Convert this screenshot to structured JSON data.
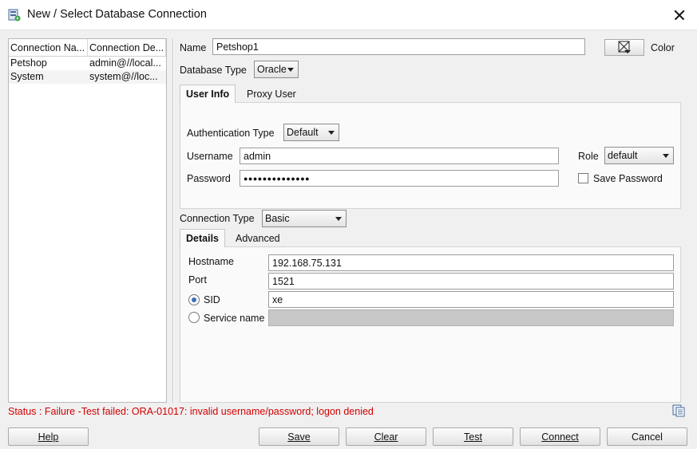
{
  "window": {
    "title": "New / Select Database Connection"
  },
  "connections": {
    "columns": [
      "Connection Na...",
      "Connection De..."
    ],
    "rows": [
      {
        "name": "Petshop",
        "details": "admin@//local..."
      },
      {
        "name": "System",
        "details": "system@//loc..."
      }
    ]
  },
  "form": {
    "name_label": "Name",
    "name_value": "Petshop1",
    "color_label": "Color",
    "db_type_label": "Database Type",
    "db_type_value": "Oracle",
    "tabs": [
      "User Info",
      "Proxy User"
    ],
    "auth_type_label": "Authentication Type",
    "auth_type_value": "Default",
    "username_label": "Username",
    "username_value": "admin",
    "password_label": "Password",
    "password_value": "●●●●●●●●●●●●●●",
    "role_label": "Role",
    "role_value": "default",
    "save_password_label": "Save Password",
    "conn_type_label": "Connection Type",
    "conn_type_value": "Basic",
    "detail_tabs": [
      "Details",
      "Advanced"
    ],
    "hostname_label": "Hostname",
    "hostname_value": "192.168.75.131",
    "port_label": "Port",
    "port_value": "1521",
    "sid_label": "SID",
    "sid_value": "xe",
    "service_label": "Service name",
    "service_value": ""
  },
  "status": {
    "text": "Status : Failure -Test failed: ORA-01017: invalid username/password; logon denied",
    "color": "#d40000"
  },
  "buttons": {
    "help": "Help",
    "save": "Save",
    "clear": "Clear",
    "test": "Test",
    "connect": "Connect",
    "cancel": "Cancel"
  },
  "icons": {
    "app": "database-connection-icon",
    "close": "close-icon",
    "color": "color-picker-icon",
    "copy": "copy-log-icon"
  }
}
